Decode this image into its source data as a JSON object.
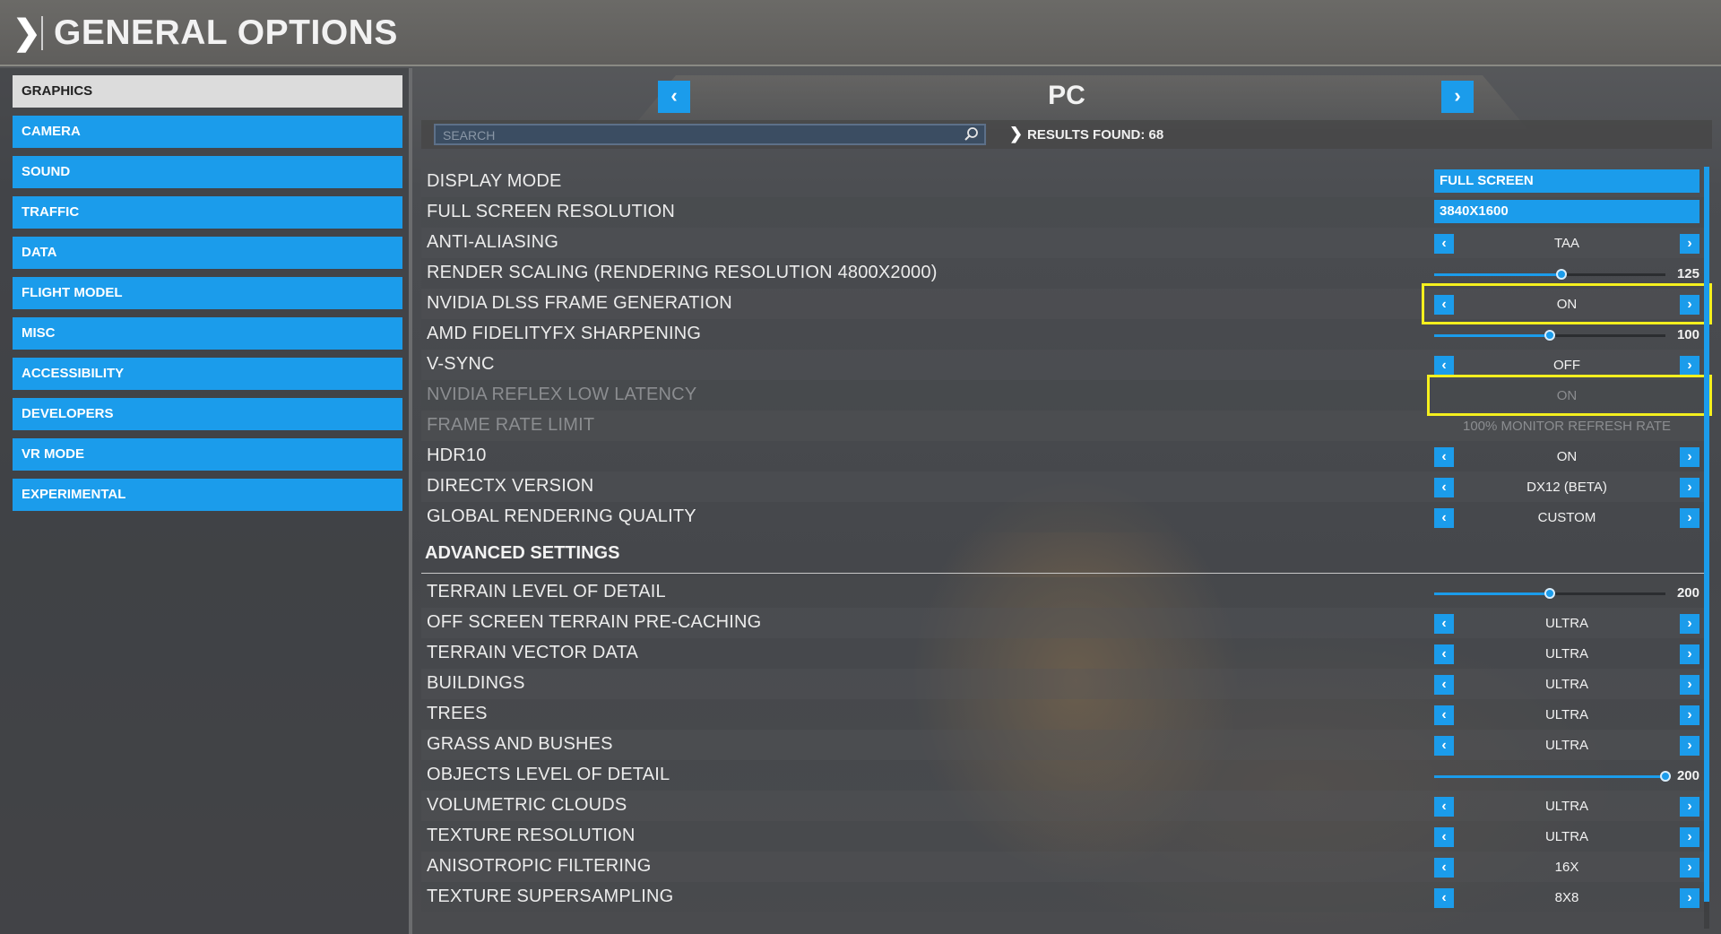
{
  "header": {
    "title": "GENERAL OPTIONS"
  },
  "sidebar": {
    "items": [
      {
        "label": "GRAPHICS",
        "active": true
      },
      {
        "label": "CAMERA"
      },
      {
        "label": "SOUND"
      },
      {
        "label": "TRAFFIC"
      },
      {
        "label": "DATA"
      },
      {
        "label": "FLIGHT MODEL"
      },
      {
        "label": "MISC"
      },
      {
        "label": "ACCESSIBILITY"
      },
      {
        "label": "DEVELOPERS"
      },
      {
        "label": "VR MODE"
      },
      {
        "label": "EXPERIMENTAL"
      }
    ]
  },
  "platform": {
    "title": "PC",
    "prev_icon": "chevron-left-icon",
    "next_icon": "chevron-right-icon"
  },
  "search": {
    "placeholder": "SEARCH",
    "results": "RESULTS FOUND: 68"
  },
  "colors": {
    "accent": "#1b9ceb",
    "highlight": "#f5f01e"
  },
  "settings": [
    {
      "label": "DISPLAY MODE",
      "type": "dropdown",
      "value": "FULL SCREEN"
    },
    {
      "label": "FULL SCREEN RESOLUTION",
      "type": "dropdown",
      "value": "3840X1600"
    },
    {
      "label": "ANTI-ALIASING",
      "type": "selector",
      "value": "TAA"
    },
    {
      "label": "RENDER SCALING (RENDERING RESOLUTION 4800X2000)",
      "type": "slider",
      "value": "125",
      "level": 0.55
    },
    {
      "label": "NVIDIA DLSS FRAME GENERATION",
      "type": "selector",
      "value": "ON",
      "highlighted": true
    },
    {
      "label": "AMD FIDELITYFX SHARPENING",
      "type": "slider",
      "value": "100",
      "level": 0.5
    },
    {
      "label": "V-SYNC",
      "type": "selector",
      "value": "OFF"
    },
    {
      "label": "NVIDIA REFLEX LOW LATENCY",
      "type": "disabled",
      "value": "ON",
      "highlighted": true
    },
    {
      "label": "FRAME RATE LIMIT",
      "type": "disabled",
      "value": "100% MONITOR REFRESH RATE"
    },
    {
      "label": "HDR10",
      "type": "selector",
      "value": "ON"
    },
    {
      "label": "DIRECTX VERSION",
      "type": "selector",
      "value": "DX12 (BETA)"
    },
    {
      "label": "GLOBAL RENDERING QUALITY",
      "type": "selector",
      "value": "CUSTOM"
    }
  ],
  "advanced": {
    "title": "ADVANCED SETTINGS",
    "settings": [
      {
        "label": "TERRAIN LEVEL OF DETAIL",
        "type": "slider",
        "value": "200",
        "level": 0.5
      },
      {
        "label": "OFF SCREEN TERRAIN PRE-CACHING",
        "type": "selector",
        "value": "ULTRA"
      },
      {
        "label": "TERRAIN VECTOR DATA",
        "type": "selector",
        "value": "ULTRA"
      },
      {
        "label": "BUILDINGS",
        "type": "selector",
        "value": "ULTRA"
      },
      {
        "label": "TREES",
        "type": "selector",
        "value": "ULTRA"
      },
      {
        "label": "GRASS AND BUSHES",
        "type": "selector",
        "value": "ULTRA"
      },
      {
        "label": "OBJECTS LEVEL OF DETAIL",
        "type": "slider",
        "value": "200",
        "level": 1.0
      },
      {
        "label": "VOLUMETRIC CLOUDS",
        "type": "selector",
        "value": "ULTRA"
      },
      {
        "label": "TEXTURE RESOLUTION",
        "type": "selector",
        "value": "ULTRA"
      },
      {
        "label": "ANISOTROPIC FILTERING",
        "type": "selector",
        "value": "16X"
      },
      {
        "label": "TEXTURE SUPERSAMPLING",
        "type": "selector",
        "value": "8X8"
      }
    ]
  }
}
